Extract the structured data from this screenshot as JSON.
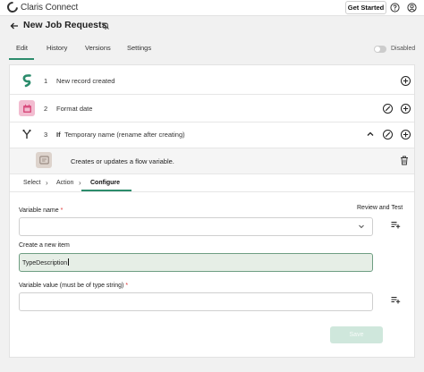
{
  "brand": {
    "name": "Claris Connect"
  },
  "topbar": {
    "get_started_label": "Get Started",
    "help_icon": "help-circle-icon",
    "user_icon": "user-icon"
  },
  "page": {
    "title": "New Job Requests",
    "back_icon": "arrow-left-icon",
    "notify_icon": "bell-off-icon"
  },
  "tabs": [
    {
      "label": "Edit",
      "active": true
    },
    {
      "label": "History",
      "active": false
    },
    {
      "label": "Versions",
      "active": false
    },
    {
      "label": "Settings",
      "active": false
    }
  ],
  "status_toggle": {
    "label": "Disabled",
    "on": false
  },
  "steps": [
    {
      "number": "1",
      "label": "New record created",
      "icon": "flow-trigger-icon",
      "color": "#2c8c6c"
    },
    {
      "number": "2",
      "label": "Format date",
      "icon": "calendar-icon",
      "color": "#d94f7f"
    },
    {
      "number": "3",
      "label": "Temporary name (rename after creating)",
      "prefix": "If",
      "icon": "branch-icon",
      "color": "#333333"
    }
  ],
  "sub_step": {
    "label": "Creates or updates a flow variable.",
    "icon": "variable-icon"
  },
  "breadcrumbs": {
    "select": "Select",
    "action": "Action",
    "configure": "Configure"
  },
  "form": {
    "review_label": "Review and Test",
    "variable_name_label": "Variable name",
    "required_mark": "*",
    "create_new_item_label": "Create a new item",
    "create_new_item_value": "TypeDescription",
    "variable_value_label": "Variable value (must be of type string)",
    "save_label": "Save"
  },
  "colors": {
    "accent": "#2c8c6c",
    "save_disabled": "#cfe7dc"
  }
}
